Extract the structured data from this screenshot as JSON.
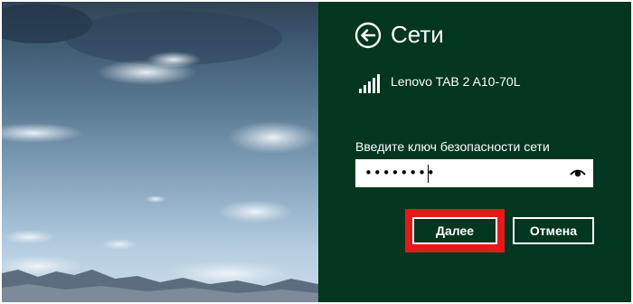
{
  "panel": {
    "title": "Сети",
    "network_name": "Lenovo TAB 2 A10-70L",
    "key_label": "Введите ключ безопасности сети",
    "key_value": "••••••••",
    "next_label": "Далее",
    "cancel_label": "Отмена"
  },
  "icons": {
    "back": "back-arrow-icon",
    "signal": "wifi-signal-icon",
    "reveal": "eye-icon"
  },
  "colors": {
    "panel_bg": "#03361f",
    "highlight": "#e21a1a"
  }
}
